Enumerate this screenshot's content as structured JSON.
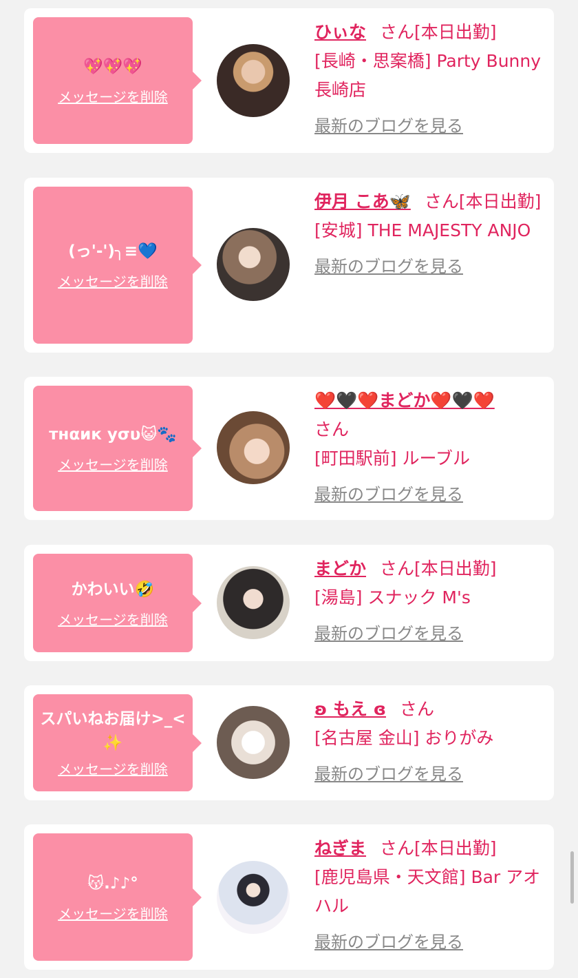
{
  "labels": {
    "delete": "メッセージを削除",
    "blog": "最新のブログを見る"
  },
  "colors": {
    "accent": "#e0245e",
    "bubble": "#fb8fa6",
    "background": "#f2f2f2",
    "card": "#ffffff",
    "link_gray": "#888888"
  },
  "items": [
    {
      "message": "💖💖💖",
      "name": "ひぃな",
      "suffix": "さん[本日出勤]",
      "shop": "[長崎・思案橋] Party Bunny 長崎店",
      "avatar_icon": "avatar-photo"
    },
    {
      "message": "(っ'-')╮≡💙",
      "name": "伊月 こあ🦋",
      "suffix": "さん[本日出勤]",
      "shop": "[安城] THE MAJESTY ANJO",
      "avatar_icon": "avatar-photo"
    },
    {
      "message": "тнαик уσυ😺🐾",
      "name": "❤️🖤❤️まどか❤️🖤❤️",
      "suffix": "さん",
      "shop": "[町田駅前] ルーブル",
      "avatar_icon": "avatar-photo"
    },
    {
      "message": "かわいい🤣",
      "name": "まどか",
      "suffix": "さん[本日出勤]",
      "shop": "[湯島] スナック M's",
      "avatar_icon": "avatar-photo"
    },
    {
      "message": "スパいねお届け>_<✨",
      "name": "ʚ もえ ɞ",
      "suffix": "さん",
      "shop": "[名古屋 金山] おりがみ",
      "avatar_icon": "avatar-photo"
    },
    {
      "message": "😽.♪♪°",
      "name": "ねぎま",
      "suffix": "さん[本日出勤]",
      "shop": "[鹿児島県・天文館] Bar アオハル",
      "avatar_icon": "avatar-photo"
    }
  ]
}
